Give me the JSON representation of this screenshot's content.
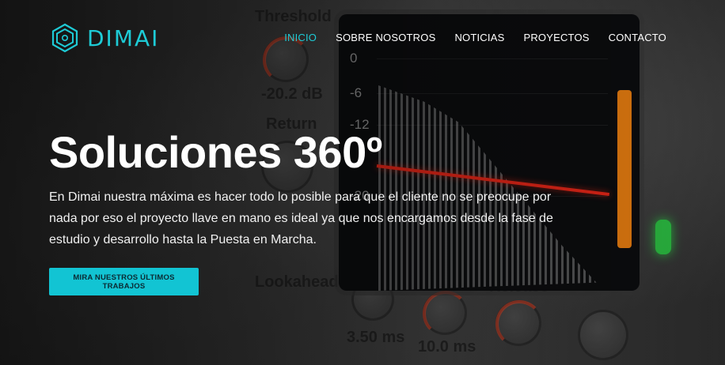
{
  "brand": {
    "name": "DIMAI",
    "accent_color": "#1ecbd6",
    "logo_icon": "hexagon-logo-icon"
  },
  "nav": {
    "items": [
      {
        "label": "INICIO",
        "active": true
      },
      {
        "label": "SOBRE NOSOTROS",
        "active": false
      },
      {
        "label": "NOTICIAS",
        "active": false
      },
      {
        "label": "PROYECTOS",
        "active": false
      },
      {
        "label": "CONTACTO",
        "active": false
      }
    ]
  },
  "hero": {
    "title": "Soluciones 360º",
    "text": "En Dimai nuestra máxima es hacer todo lo posible para que el cliente no se preocupe por nada por eso el proyecto llave en mano es ideal ya que nos encargamos desde la fase de estudio y desarrollo hasta la Puesta en Marcha.",
    "cta_label": "MIRA NUESTROS ÚLTIMOS TRABAJOS",
    "cta_color": "#12c4d3"
  }
}
